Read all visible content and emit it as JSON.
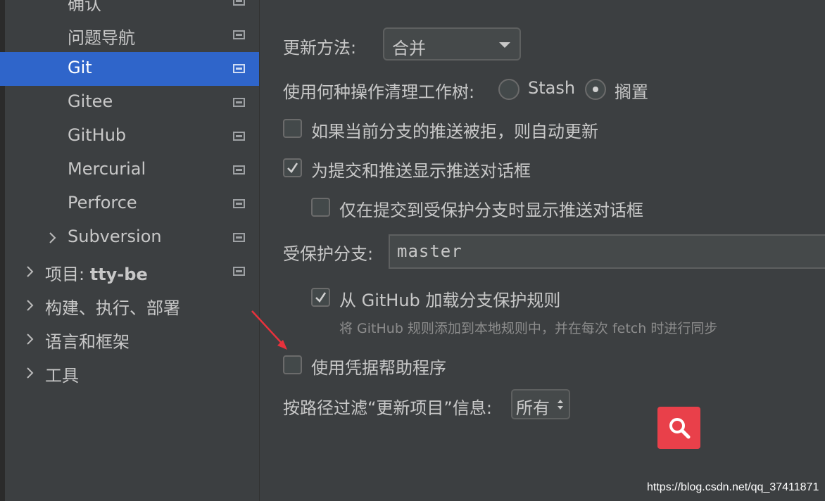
{
  "sidebar": {
    "items": [
      {
        "label": "确认",
        "selected": false
      },
      {
        "label": "问题导航",
        "selected": false
      },
      {
        "label": "Git",
        "selected": true
      },
      {
        "label": "Gitee",
        "selected": false
      },
      {
        "label": "GitHub",
        "selected": false
      },
      {
        "label": "Mercurial",
        "selected": false
      },
      {
        "label": "Perforce",
        "selected": false
      },
      {
        "label": "Subversion",
        "selected": false
      },
      {
        "label_prefix": "项目: ",
        "label_bold": "tty-be",
        "selected": false
      },
      {
        "label": "构建、执行、部署",
        "selected": false
      },
      {
        "label": "语言和框架",
        "selected": false
      },
      {
        "label": "工具",
        "selected": false
      }
    ]
  },
  "settings": {
    "update_method": {
      "label": "更新方法:",
      "value": "合并"
    },
    "clean_tree": {
      "label": "使用何种操作清理工作树:",
      "option_stash": "Stash",
      "option_shelve": "搁置",
      "selected": "搁置"
    },
    "auto_update": {
      "label": "如果当前分支的推送被拒，则自动更新",
      "checked": false
    },
    "push_dialog": {
      "label": "为提交和推送显示推送对话框",
      "checked": true
    },
    "protected_only": {
      "label": "仅在提交到受保护分支时显示推送对话框",
      "checked": false
    },
    "protected_branches": {
      "label": "受保护分支:",
      "value": "master"
    },
    "github_rules": {
      "label": "从 GitHub 加载分支保护规则",
      "checked": true,
      "hint": "将 GitHub 规则添加到本地规则中，并在每次 fetch 时进行同步"
    },
    "credential_helper": {
      "label": "使用凭据帮助程序",
      "checked": false
    },
    "filter": {
      "label": "按路径过滤“更新项目”信息:",
      "value": "所有"
    }
  },
  "watermark": "https://blog.csdn.net/qq_37411871",
  "colors": {
    "accent": "#2f65ca",
    "annotation": "#e8323c",
    "search": "#e9404a"
  }
}
